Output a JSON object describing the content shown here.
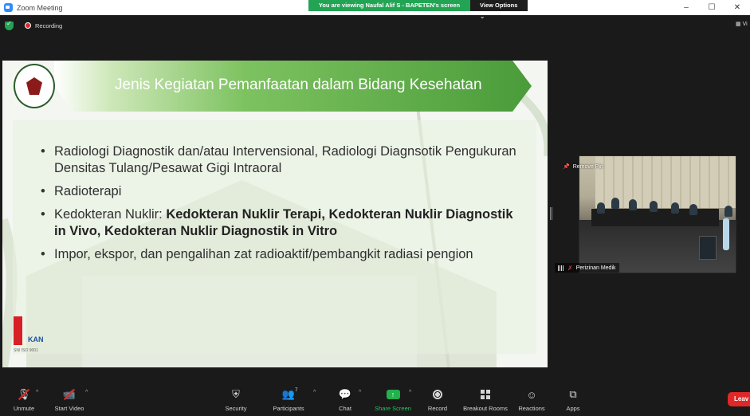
{
  "window": {
    "title": "Zoom Meeting"
  },
  "banner": {
    "message": "You are viewing Naufal Alif S - BAPETEN's screen",
    "view_options": "View Options ⌄"
  },
  "status": {
    "recording_label": "Recording",
    "view_label": "Vi"
  },
  "slide": {
    "title": "Jenis Kegiatan Pemanfaatan dalam Bidang Kesehatan",
    "bullets": [
      {
        "text": "Radiologi Diagnostik dan/atau Intervensional, Radiologi Diagnsotik Pengukuran Densitas Tulang/Pesawat Gigi Intraoral"
      },
      {
        "text": "Radioterapi"
      },
      {
        "prefix": "Kedokteran Nuklir: ",
        "bold": "Kedokteran Nuklir Terapi, Kedokteran Nuklir Diagnostik in Vivo, Kedokteran Nuklir Diagnostik in Vitro"
      },
      {
        "text": "Impor, ekspor, dan pengalihan zat radioaktif/pembangkit radiasi pengion"
      }
    ],
    "cert": {
      "kan": "KAN",
      "small": "SNI ISO\n9001"
    }
  },
  "video": {
    "remove_pin": "Remove Pin",
    "participant_name": "Perizinan Medik"
  },
  "toolbar": {
    "unmute": "Unmute",
    "start_video": "Start Video",
    "security": "Security",
    "participants": "Participants",
    "participants_count": "7",
    "chat": "Chat",
    "share_screen": "Share Screen",
    "record": "Record",
    "breakout_rooms": "Breakout Rooms",
    "reactions": "Reactions",
    "apps": "Apps",
    "leave": "Leav"
  },
  "colors": {
    "share_green": "#22b14c",
    "leave_red": "#e02828",
    "banner_green": "#23a455"
  }
}
